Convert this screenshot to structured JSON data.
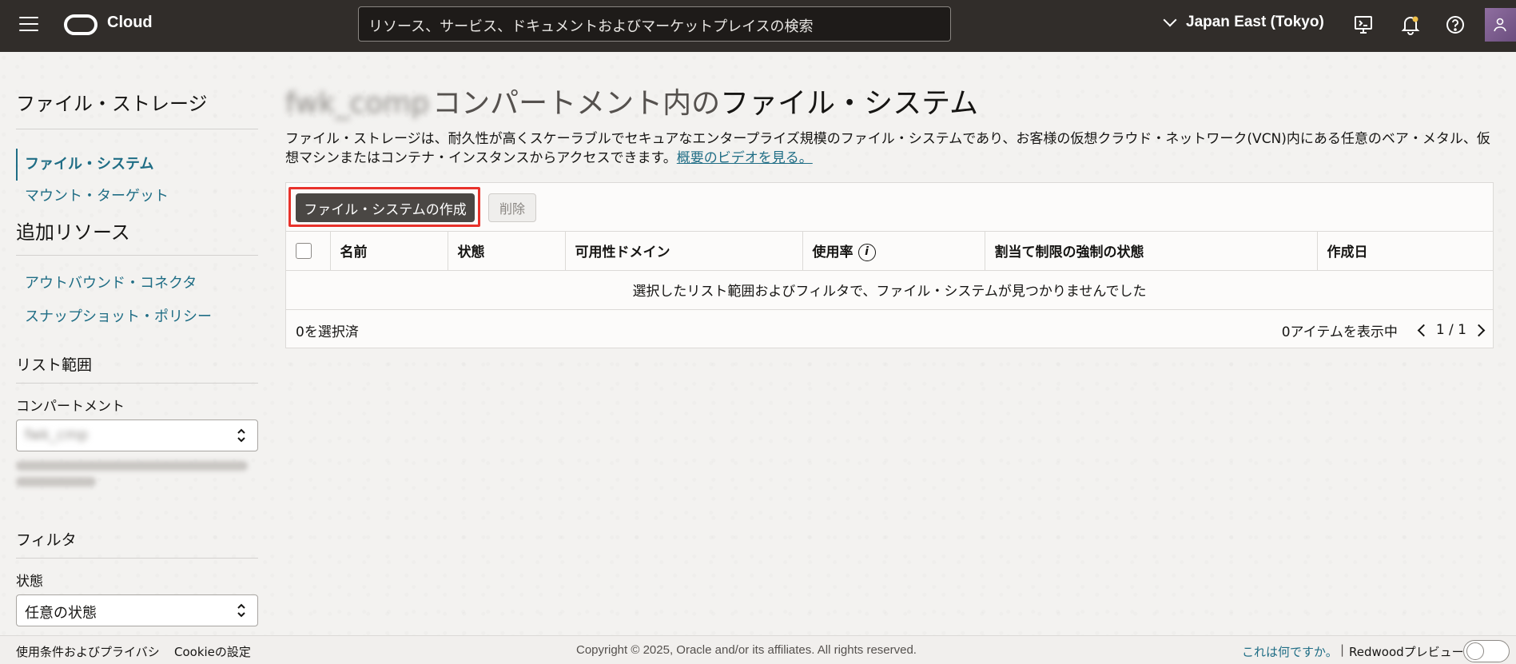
{
  "header": {
    "brand": "Cloud",
    "search_placeholder": "リソース、サービス、ドキュメントおよびマーケットプレイスの検索",
    "region": "Japan East (Tokyo)"
  },
  "sidebar": {
    "title": "ファイル・ストレージ",
    "nav": [
      {
        "label": "ファイル・システム",
        "active": true
      },
      {
        "label": "マウント・ターゲット",
        "active": false
      }
    ],
    "additional_title": "追加リソース",
    "additional": [
      {
        "label": "アウトバウンド・コネクタ"
      },
      {
        "label": "スナップショット・ポリシー"
      }
    ],
    "scope_title": "リスト範囲",
    "compartment_label": "コンパートメント",
    "compartment_value": "fwk_cmp",
    "filter_title": "フィルタ",
    "state_label": "状態",
    "state_value": "任意の状態"
  },
  "main": {
    "title_compartment": "fwk_comp",
    "title_middle": "コンパートメント内の",
    "title_end": "ファイル・システム",
    "description": "ファイル・ストレージは、耐久性が高くスケーラブルでセキュアなエンタープライズ規模のファイル・システムであり、お客様の仮想クラウド・ネットワーク(VCN)内にある任意のベア・メタル、仮想マシンまたはコンテナ・インスタンスからアクセスできます。",
    "video_link": "概要のビデオを見る。"
  },
  "toolbar": {
    "create_label": "ファイル・システムの作成",
    "delete_label": "削除"
  },
  "table": {
    "columns": [
      "名前",
      "状態",
      "可用性ドメイン",
      "使用率",
      "割当て制限の強制の状態",
      "作成日"
    ],
    "empty_message": "選択したリスト範囲およびフィルタで、ファイル・システムが見つかりませんでした",
    "selected_count": "0を選択済",
    "items_shown": "0アイテムを表示中",
    "page": "1 / 1"
  },
  "footer": {
    "terms": "使用条件およびプライバシ",
    "cookie": "Cookieの設定",
    "copyright": "Copyright © 2025, Oracle and/or its affiliates. All rights reserved.",
    "what_is_this": "これは何ですか。",
    "separator": "|",
    "redwood_preview": "Redwoodプレビュー"
  },
  "colors": {
    "header_bg": "#312d2a",
    "link": "#1f6d85",
    "highlight": "#e8322b",
    "primary_button": "#4a4744"
  }
}
